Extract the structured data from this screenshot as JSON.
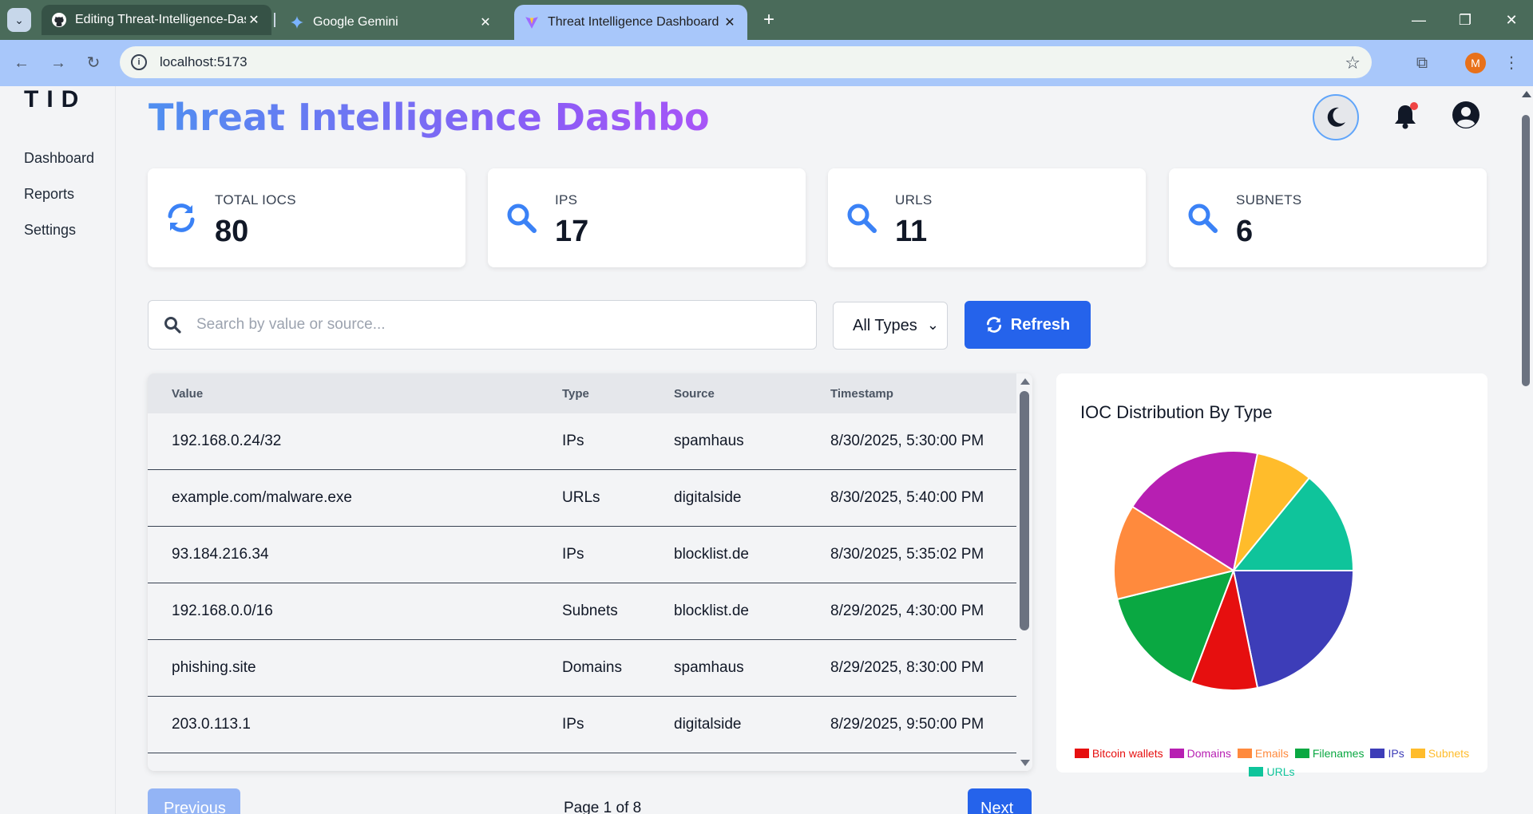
{
  "browser": {
    "tabs": [
      {
        "title": "Editing Threat-Intelligence-Das"
      },
      {
        "title": "Google Gemini"
      },
      {
        "title": "Threat Intelligence Dashboard"
      }
    ],
    "url": "localhost:5173",
    "profile_initial": "M"
  },
  "sidebar": {
    "logo": "TID",
    "items": [
      {
        "label": "Dashboard"
      },
      {
        "label": "Reports"
      },
      {
        "label": "Settings"
      }
    ]
  },
  "header": {
    "title": "Threat Intelligence Dashbo"
  },
  "stats": [
    {
      "label": "TOTAL IOCS",
      "value": "80",
      "icon": "refresh-icon"
    },
    {
      "label": "IPS",
      "value": "17",
      "icon": "search-icon"
    },
    {
      "label": "URLS",
      "value": "11",
      "icon": "search-icon"
    },
    {
      "label": "SUBNETS",
      "value": "6",
      "icon": "search-icon"
    }
  ],
  "filters": {
    "search_placeholder": "Search by value or source...",
    "type_selected": "All Types",
    "refresh_label": "Refresh"
  },
  "table": {
    "headers": [
      "Value",
      "Type",
      "Source",
      "Timestamp"
    ],
    "rows": [
      [
        "192.168.0.24/32",
        "IPs",
        "spamhaus",
        "8/30/2025, 5:30:00 PM"
      ],
      [
        "example.com/malware.exe",
        "URLs",
        "digitalside",
        "8/30/2025, 5:40:00 PM"
      ],
      [
        "93.184.216.34",
        "IPs",
        "blocklist.de",
        "8/30/2025, 5:35:02 PM"
      ],
      [
        "192.168.0.0/16",
        "Subnets",
        "blocklist.de",
        "8/29/2025, 4:30:00 PM"
      ],
      [
        "phishing.site",
        "Domains",
        "spamhaus",
        "8/29/2025, 8:30:00 PM"
      ],
      [
        "203.0.113.1",
        "IPs",
        "digitalside",
        "8/29/2025, 9:50:00 PM"
      ]
    ]
  },
  "pagination": {
    "prev_label": "Previous",
    "page_info": "Page 1 of 8",
    "next_label": "Next"
  },
  "chart_data": {
    "type": "pie",
    "title": "IOC Distribution By Type",
    "categories": [
      "Bitcoin wallets",
      "Domains",
      "Emails",
      "Filenames",
      "IPs",
      "Subnets",
      "URLs"
    ],
    "values": [
      7,
      15,
      10,
      12,
      17,
      6,
      11
    ],
    "colors": [
      "#e60f0f",
      "#b71fb2",
      "#ff8a3d",
      "#0aa842",
      "#3d3db8",
      "#ffbc2b",
      "#0fc49b"
    ],
    "slice_order": [
      "IPs",
      "Bitcoin wallets",
      "Filenames",
      "Emails",
      "Domains",
      "Subnets",
      "URLs"
    ],
    "legend_position": "bottom"
  }
}
